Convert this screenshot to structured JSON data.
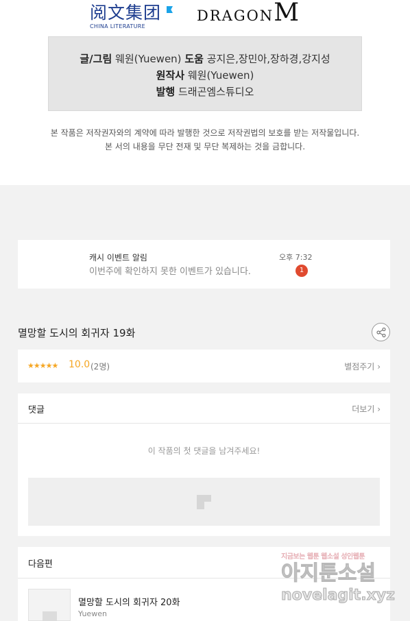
{
  "header": {
    "logo_china_literature_cn": "阅文集团",
    "logo_china_literature_en": "CHINA LITERATURE",
    "logo_dragon": "DRAGON",
    "logo_dragon_m": "M"
  },
  "credits": {
    "writer_label": "글/그림",
    "writer_value": "웨원(Yuewen)",
    "assist_label": "도움",
    "assist_value": "공지은,장민아,장하경,강지성",
    "original_label": "원작사",
    "original_value": "웨원(Yuewen)",
    "publisher_label": "발행",
    "publisher_value": "드래곤엠스튜디오"
  },
  "copyright_notice": {
    "line1": "본 작품은 저작권자와의 계약에 따라 발행한 것으로 저작권법의 보호를 받는 저작물입니다.",
    "line2": "본 서의 내용을 무단 전재 및 무단 복제하는 것을 금합니다."
  },
  "alert": {
    "title": "캐시 이벤트 알림",
    "message": "이번주에 확인하지 못한 이벤트가 있습니다.",
    "time": "오후 7:32",
    "badge_count": "1",
    "badge_color": "#e04a2f"
  },
  "episode": {
    "title": "멸망할 도시의 회귀자 19화",
    "share_icon": "share-icon"
  },
  "rating": {
    "stars": "★★★★★",
    "score": "10.0",
    "count": "(2명)",
    "rate_label": "별점주기",
    "accent_color": "#f5a623"
  },
  "comments": {
    "header": "댓글",
    "more_label": "더보기",
    "empty_message": "이 작품의 첫 댓글을 남겨주세요!"
  },
  "next_episode": {
    "header": "다음편",
    "title": "멸망할 도시의 회귀자 20화",
    "author": "Yuewen"
  },
  "watermark": {
    "small": "지금보는 웹툰 웹소설 성인웹툰",
    "big": "아지툰소설",
    "url": "novelagit.xyz"
  }
}
